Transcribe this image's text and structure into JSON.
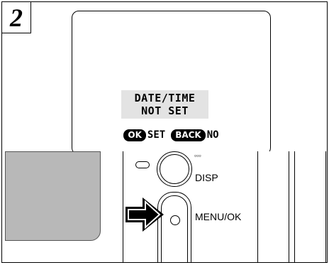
{
  "step": {
    "number": "2"
  },
  "lcd": {
    "message_line1": "DATE/TIME",
    "message_line2": "NOT SET",
    "softkeys": [
      {
        "key": "OK",
        "label": "SET"
      },
      {
        "key": "BACK",
        "label": "NO"
      }
    ]
  },
  "camera": {
    "disp_label": "DISP",
    "menu_label": "MENU/OK"
  }
}
